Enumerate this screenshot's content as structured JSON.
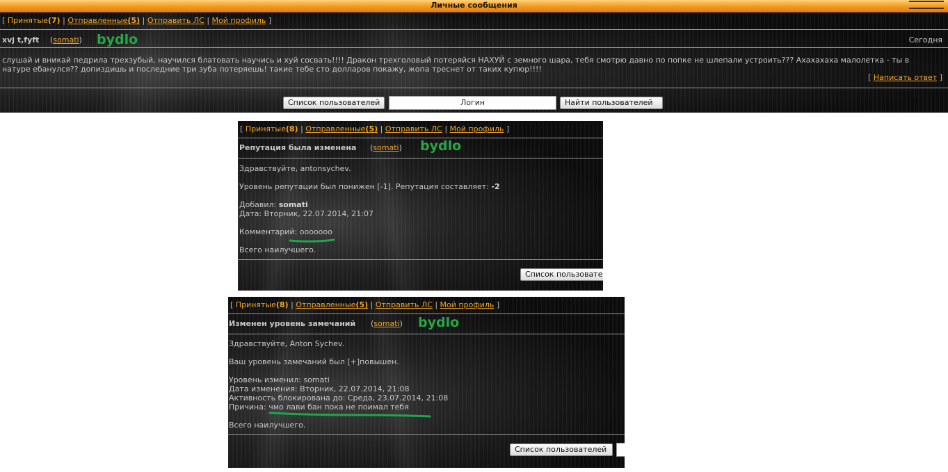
{
  "window": {
    "title": "Личные сообщения"
  },
  "nav_first": {
    "bracket_open": "[",
    "inbox_label": "Принятые",
    "inbox_count": "(7)",
    "sent_label": "Отправленные",
    "sent_count": "(5)",
    "send_pm": "Отправить ЛС",
    "profile": "Мой профиль",
    "separator": "|",
    "bracket_close": "]"
  },
  "nav_other": {
    "bracket_open": "[",
    "inbox_label": "Принятые",
    "inbox_count": "(8)",
    "sent_label": "Отправленные",
    "sent_count": "(5)",
    "send_pm": "Отправить ЛС",
    "profile": "Мой профиль",
    "separator": "|",
    "bracket_close": "]"
  },
  "message1": {
    "subject": "xvj t,fyft",
    "author_open": "(",
    "author": "somati",
    "author_close": ")",
    "annotation": "bydlo",
    "date": "Сегодня",
    "body": "слушай и вникай педрила трехзубый, научился блатовать научись и хуй сосвать!!!! Дракон трехголовый потеряйся НАХУЙ с земного шара, тебя смотрю давно по попке не шлепали устроить??? Ахахахаха малолетка - ты в натуре ебанулся?? допиздишь и последние три зуба потеряешь! такие тебе сто долларов покажу, жопа треснет от таких купюр!!!!",
    "reply_open": "[",
    "reply": "Написать ответ",
    "reply_close": "]"
  },
  "search": {
    "users_list": "Список пользователей",
    "login_placeholder": "Логин",
    "find_users": "Найти пользователей"
  },
  "message2": {
    "subject": "Репутация была изменена",
    "author_open": "(",
    "author": "somati",
    "author_close": ")",
    "annotation": "bydlo",
    "greeting": "Здравствуйте, antonsychev.",
    "rep_text": "Уровень репутации был понижен [-1]. Репутация составляет:",
    "rep_value": "-2",
    "added_label": "Добавил:",
    "added_by": "somati",
    "date_line": "Дата: Вторник, 22.07.2014, 21:07",
    "comment_label": "Комментарий:",
    "comment": "ooooooo",
    "closing": "Всего наилучшего.",
    "users_list": "Список пользователей"
  },
  "message3": {
    "subject": "Изменен уровень замечаний",
    "author_open": "(",
    "author": "somati",
    "author_close": ")",
    "annotation": "bydlo",
    "greeting": "Здравствуйте, Anton Sychev.",
    "level_text": "Ваш уровень замечаний был [+]повышен.",
    "changed_by": "Уровень изменил: somati",
    "change_date": "Дата изменения: Вторник, 22.07.2014, 21:08",
    "blocked_until": "Активность блокирована до: Среда, 23.07.2014, 21:08",
    "reason_label": "Причина:",
    "reason": "чмо лави бан пока не поимал тебя",
    "closing": "Всего наилучшего.",
    "users_list": "Список пользователей"
  },
  "colors": {
    "accent": "#f5a623",
    "annotation": "#25a845",
    "titlebar": "#f29a1f"
  }
}
